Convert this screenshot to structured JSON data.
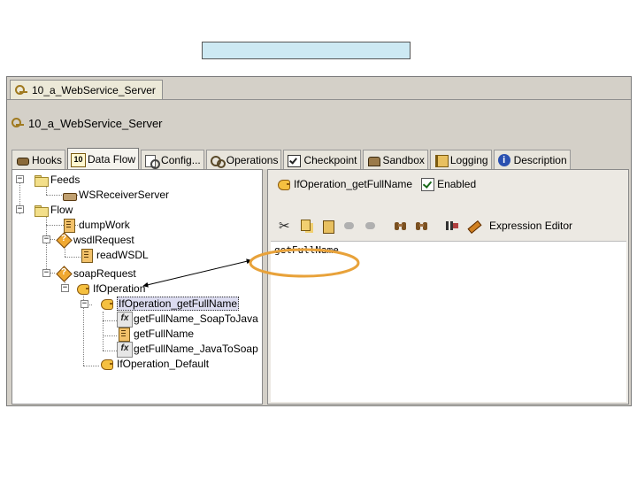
{
  "window": {
    "doc_tab_label": "10_a_WebService_Server",
    "title": "10_a_WebService_Server"
  },
  "tabs": [
    {
      "label": "Hooks",
      "icon": "hook-icon"
    },
    {
      "label": "Data Flow",
      "icon": "dataflow-icon",
      "active": true
    },
    {
      "label": "Config...",
      "icon": "config-icon"
    },
    {
      "label": "Operations",
      "icon": "operations-icon"
    },
    {
      "label": "Checkpoint",
      "icon": "checkpoint-icon"
    },
    {
      "label": "Sandbox",
      "icon": "sandbox-icon"
    },
    {
      "label": "Logging",
      "icon": "logging-icon"
    },
    {
      "label": "Description",
      "icon": "info-icon"
    }
  ],
  "tree": {
    "feeds": "Feeds",
    "ws_receiver_server": "WSReceiverServer",
    "flow": "Flow",
    "dump_work": "dumpWork",
    "wsdl_request": "wsdlRequest",
    "read_wsdl": "readWSDL",
    "soap_request": "soapRequest",
    "if_operation": "IfOperation",
    "if_operation_get_full_name": "IfOperation_getFullName",
    "get_full_name_soap_to_java": "getFullName_SoapToJava",
    "get_full_name": "getFullName",
    "get_full_name_java_to_soap": "getFullName_JavaToSoap",
    "if_operation_default": "IfOperation_Default"
  },
  "detail": {
    "node_name": "IfOperation_getFullName",
    "enabled_label": "Enabled",
    "enabled": true,
    "expression_editor_label": "Expression Editor",
    "code": "getFullName"
  },
  "colors": {
    "highlight_ring": "#e8a23a",
    "top_bar": "#cde9f3",
    "window_bg": "#d4d0c8"
  }
}
